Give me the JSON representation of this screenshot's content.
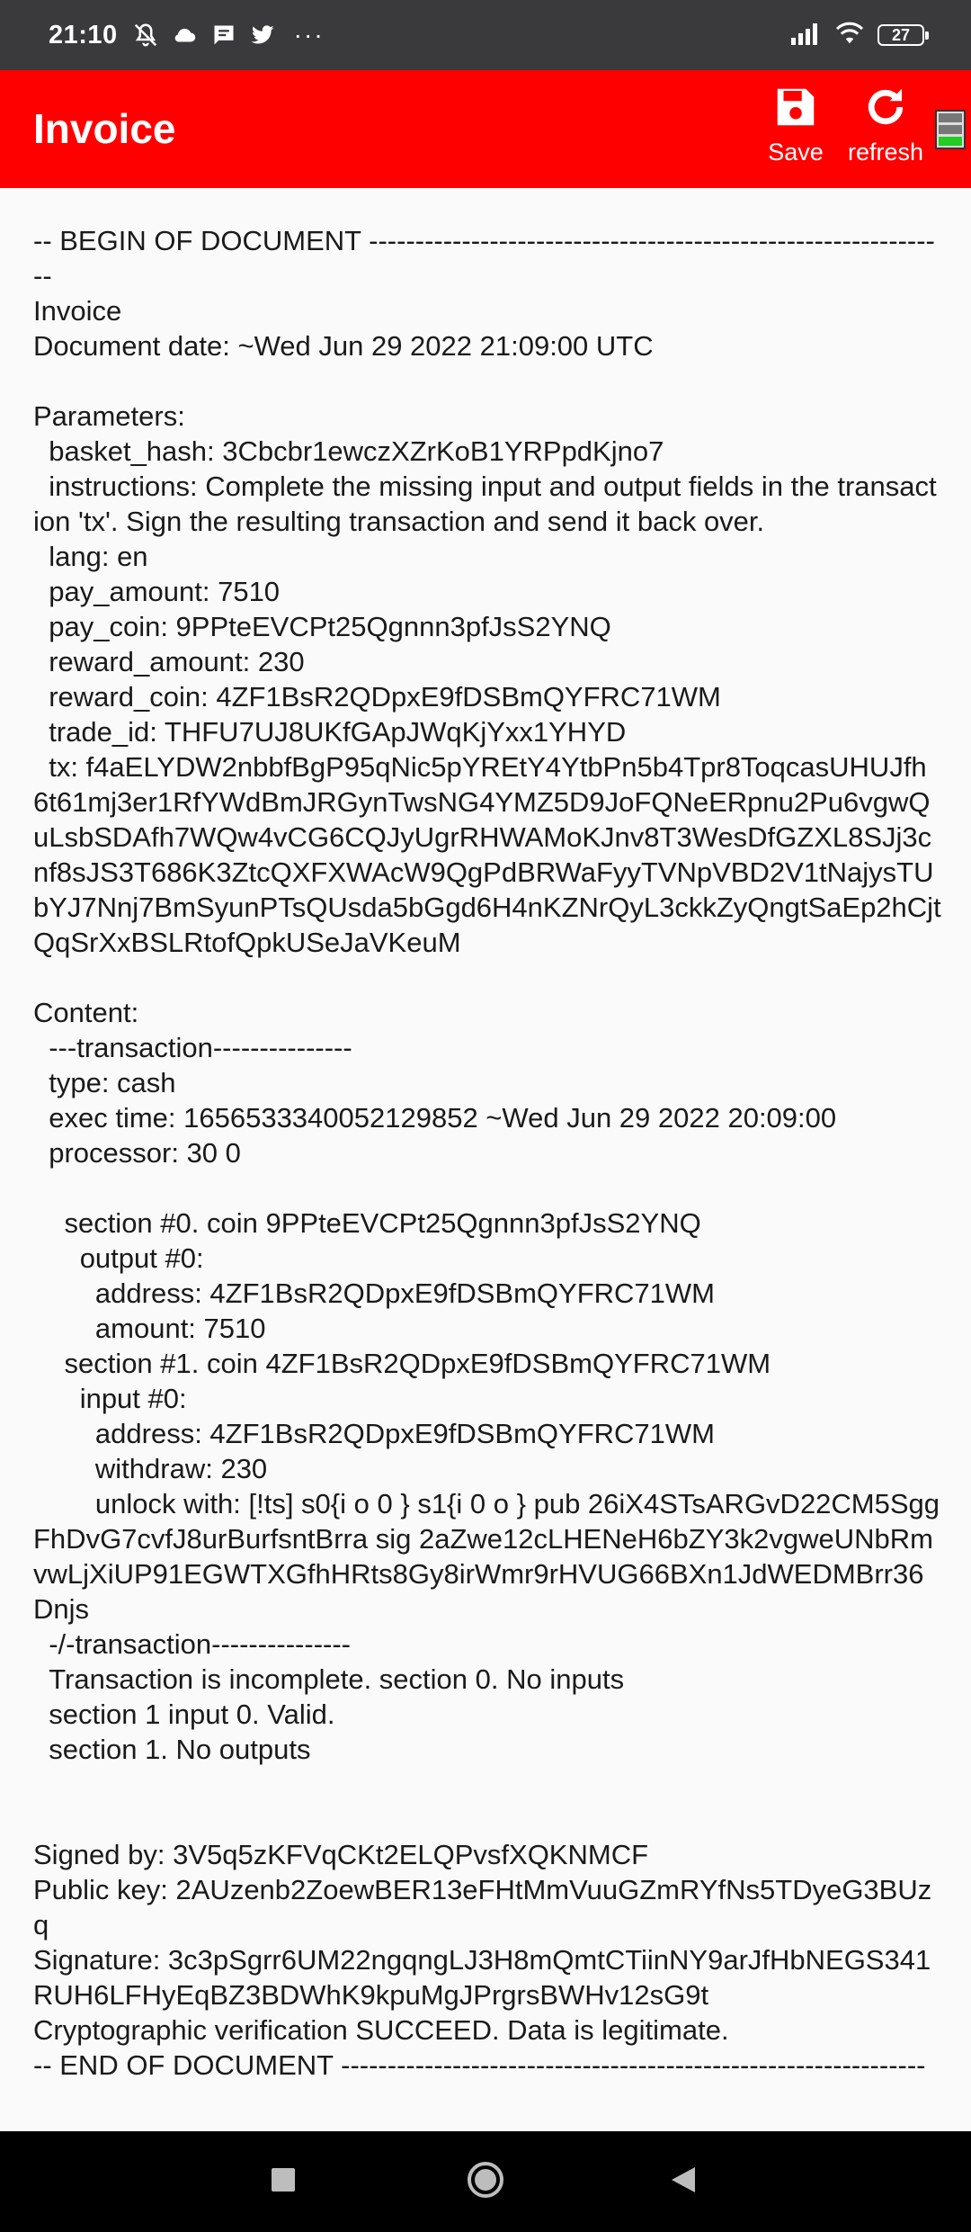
{
  "status_bar": {
    "time": "21:10",
    "overflow": "···",
    "battery": "27",
    "icons": [
      "mute-bell-icon",
      "cloud-icon",
      "message-icon",
      "twitter-icon",
      "signal-icon",
      "wifi-icon",
      "battery-icon"
    ]
  },
  "app_bar": {
    "title": "Invoice",
    "save_label": "Save",
    "refresh_label": "refresh",
    "accent_color": "#ff0000"
  },
  "document": {
    "lines": [
      "-- BEGIN OF DOCUMENT ---------------------------------------------------------------",
      "Invoice",
      "Document date: ~Wed Jun 29 2022 21:09:00 UTC",
      "",
      "Parameters:",
      "  basket_hash: 3Cbcbr1ewczXZrKoB1YRPpdKjno7",
      "  instructions: Complete the missing input and output fields in the transaction 'tx'. Sign the resulting transaction and send it back over.",
      "  lang: en",
      "  pay_amount: 7510",
      "  pay_coin: 9PPteEVCPt25Qgnnn3pfJsS2YNQ",
      "  reward_amount: 230",
      "  reward_coin: 4ZF1BsR2QDpxE9fDSBmQYFRC71WM",
      "  trade_id: THFU7UJ8UKfGApJWqKjYxx1YHYD",
      "  tx: f4aELYDW2nbbfBgP95qNic5pYREtY4YtbPn5b4Tpr8ToqcasUHUJfh6t61mj3er1RfYWdBmJRGynTwsNG4YMZ5D9JoFQNeERpnu2Pu6vgwQuLsbSDAfh7WQw4vCG6CQJyUgrRHWAMoKJnv8T3WesDfGZXL8SJj3cnf8sJS3T686K3ZtcQXFXWAcW9QgPdBRWaFyyTVNpVBD2V1tNajysTUbYJ7Nnj7BmSyunPTsQUsda5bGgd6H4nKZNrQyL3ckkZyQngtSaEp2hCjtQqSrXxBSLRtofQpkUSeJaVKeuM",
      "",
      "Content:",
      "  ---transaction---------------",
      "  type: cash",
      "  exec time: 1656533340052129852 ~Wed Jun 29 2022 20:09:00",
      "  processor: 30 0",
      "",
      "    section #0. coin 9PPteEVCPt25Qgnnn3pfJsS2YNQ",
      "      output #0:",
      "        address: 4ZF1BsR2QDpxE9fDSBmQYFRC71WM",
      "        amount: 7510",
      "    section #1. coin 4ZF1BsR2QDpxE9fDSBmQYFRC71WM",
      "      input #0:",
      "        address: 4ZF1BsR2QDpxE9fDSBmQYFRC71WM",
      "        withdraw: 230",
      "        unlock with: [!ts] s0{i o 0 } s1{i 0 o } pub 26iX4STsARGvD22CM5SggFhDvG7cvfJ8urBurfsntBrra sig 2aZwe12cLHENeH6bZY3k2vgweUNbRmvwLjXiUP91EGWTXGfhHRts8Gy8irWmr9rHVUG66BXn1JdWEDMBrr36Dnjs",
      "  -/-transaction---------------",
      "  Transaction is incomplete. section 0. No inputs",
      "  section 1 input 0. Valid.",
      "  section 1. No outputs",
      "",
      "",
      "Signed by: 3V5q5zKFVqCKt2ELQPvsfXQKNMCF",
      "Public key: 2AUzenb2ZoewBER13eFHtMmVuuGZmRYfNs5TDyeG3BUzq",
      "Signature: 3c3pSgrr6UM22ngqngLJ3H8mQmtCTiinNY9arJfHbNEGS341RUH6LFHyEqBZ3BDWhK9kpuMgJPrgrsBWHv12sG9t",
      "Cryptographic verification SUCCEED. Data is legitimate.",
      "-- END OF DOCUMENT ---------------------------------------------------------------"
    ]
  },
  "nav_bar": {
    "icons": [
      "recent-apps-icon",
      "home-icon",
      "back-icon"
    ]
  }
}
